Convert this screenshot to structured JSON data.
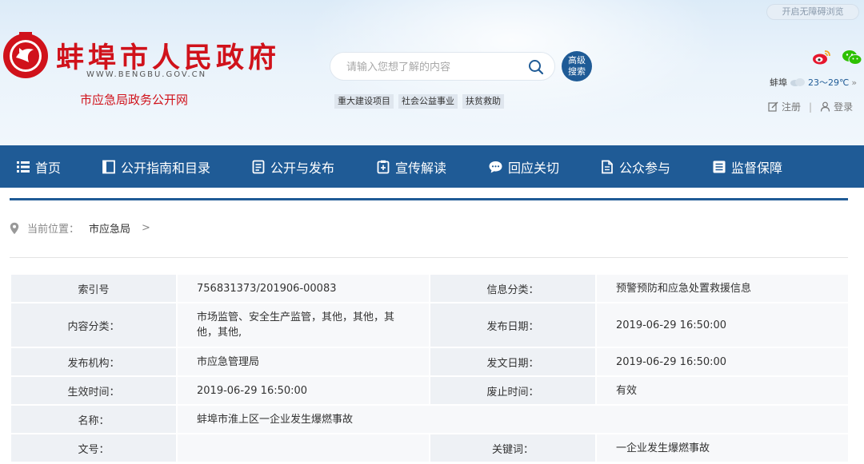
{
  "header": {
    "accessibility_label": "开启无障碍浏览",
    "site_title": "蚌埠市人民政府",
    "site_url": "WWW.BENGBU.GOV.CN",
    "site_subtitle": "市应急局政务公开网",
    "emblem_text": "BENGBU CHINA",
    "search_placeholder": "请输入您想了解的内容",
    "advanced_search_label": [
      "高级",
      "搜索"
    ],
    "hot_tags": [
      "重大建设项目",
      "社会公益事业",
      "扶贫救助"
    ],
    "weather": {
      "city": "蚌埠",
      "temp": "23～29℃",
      "more": "»"
    },
    "register_label": "注册",
    "login_label": "登录",
    "separator": "|"
  },
  "nav": {
    "items": [
      {
        "label": "首页",
        "icon": "list-icon"
      },
      {
        "label": "公开指南和目录",
        "icon": "book-icon"
      },
      {
        "label": "公开与发布",
        "icon": "document-icon"
      },
      {
        "label": "宣传解读",
        "icon": "clipboard-icon"
      },
      {
        "label": "回应关切",
        "icon": "chat-icon"
      },
      {
        "label": "公众参与",
        "icon": "edit-document-icon"
      },
      {
        "label": "监督保障",
        "icon": "list-box-icon"
      }
    ]
  },
  "breadcrumb": {
    "prefix": "当前位置：",
    "current": "市应急局",
    "arrow": ">"
  },
  "info": {
    "rows": [
      {
        "label1": "索引号",
        "value1": "756831373/201906-00083",
        "label2": "信息分类：",
        "value2": "预警预防和应急处置救援信息"
      },
      {
        "label1": "内容分类：",
        "value1": "市场监管、安全生产监管，其他，其他，其他，其他,",
        "label2": "发布日期：",
        "value2": "2019-06-29 16:50:00"
      },
      {
        "label1": "发布机构：",
        "value1": "市应急管理局",
        "label2": "发文日期：",
        "value2": "2019-06-29 16:50:00"
      },
      {
        "label1": "生效时间：",
        "value1": "2019-06-29 16:50:00",
        "label2": "废止时间：",
        "value2": "有效"
      }
    ],
    "name_label": "名称：",
    "name_value": "蚌埠市淮上区一企业发生爆燃事故",
    "docno_label": "文号：",
    "docno_value": "",
    "keyword_label": "关键词：",
    "keyword_value": "一企业发生爆燃事故"
  },
  "colors": {
    "brand_blue": "#1f5b96",
    "brand_red": "#d0121b"
  }
}
